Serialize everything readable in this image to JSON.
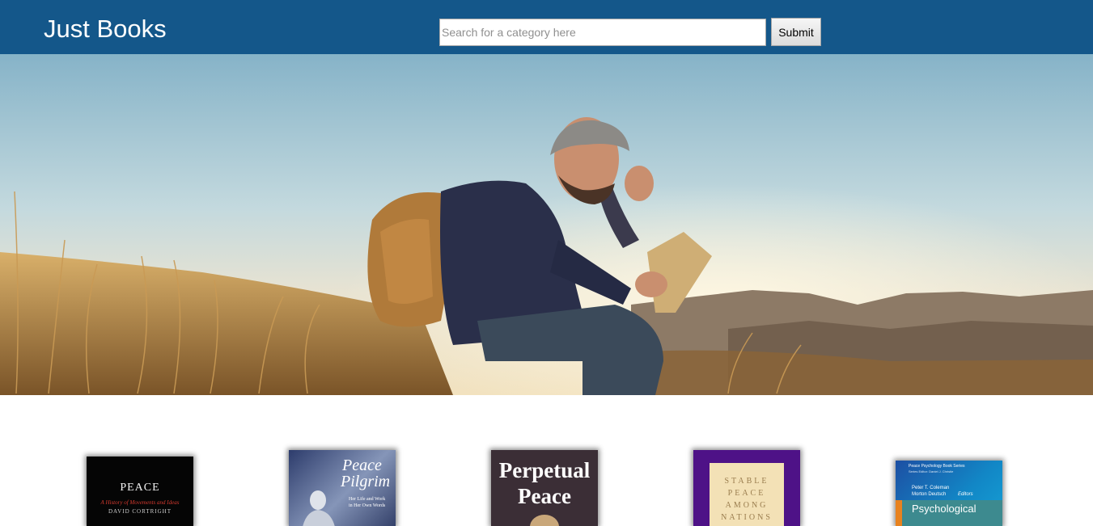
{
  "header": {
    "brand": "Just Books",
    "search_placeholder": "Search for a category here",
    "search_value": "",
    "submit_label": "Submit"
  },
  "books": [
    {
      "title": "PEACE",
      "subtitle": "A History of Movements and Ideas",
      "author": "DAVID CORTRIGHT"
    },
    {
      "title_line1": "Peace",
      "title_line2": "Pilgrim",
      "subtitle_line1": "Her Life and Work",
      "subtitle_line2": "in Her Own Words"
    },
    {
      "title_line1": "Perpetual",
      "title_line2": "Peace"
    },
    {
      "title_line1": "STABLE",
      "title_line2": "PEACE",
      "title_line3": "AMONG",
      "title_line4": "NATIONS"
    },
    {
      "series": "Peace Psychology Book Series",
      "series_editor": "Series Editor: Daniel J. Christie",
      "editor1": "Peter T. Coleman",
      "editor2": "Morton Deutsch",
      "editors_label": "Editors",
      "title": "Psychological"
    }
  ]
}
